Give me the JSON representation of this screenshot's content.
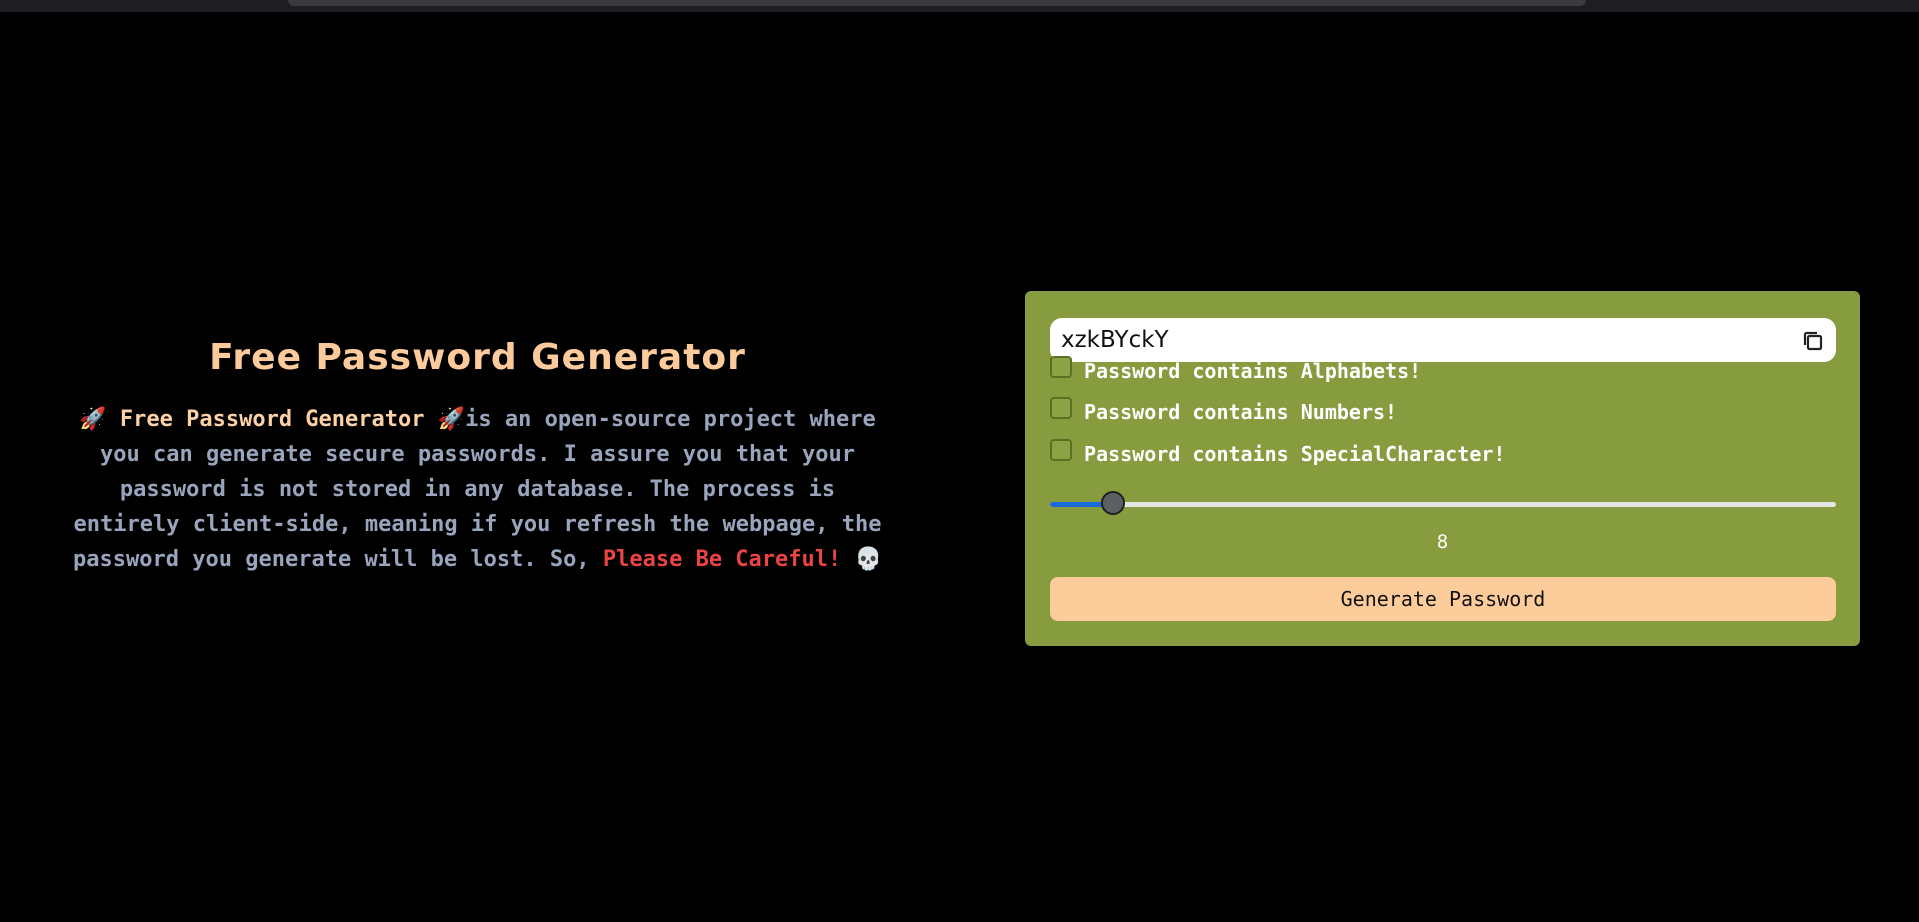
{
  "colors": {
    "background": "#000000",
    "title": "#fdcb9b",
    "body_text": "#99a5bd",
    "highlight": "#fdd1a4",
    "warning": "#ea4444",
    "panel": "#879c3f",
    "button": "#fdcc9b",
    "slider_fill": "#1b6ad9"
  },
  "intro": {
    "title": "Free Password Generator",
    "rocket_left": "🚀",
    "project_name": "Free Password Generator",
    "rocket_right": "🚀",
    "description": "is an open-source project where you can generate secure passwords. I assure you that your password is not stored in any database. The process is entirely client-side, meaning if you refresh the webpage, the password you generate will be lost. So,",
    "warning": "Please Be Careful!",
    "skull": "💀"
  },
  "generator": {
    "password": "xzkBYckY",
    "copy_icon": "copy-icon",
    "options": [
      {
        "label": "Password contains Alphabets!",
        "checked": false
      },
      {
        "label": "Password contains Numbers!",
        "checked": false
      },
      {
        "label": "Password contains SpecialCharacter!",
        "checked": false
      }
    ],
    "length": "8",
    "length_fraction": 0.08,
    "generate_label": "Generate Password"
  }
}
